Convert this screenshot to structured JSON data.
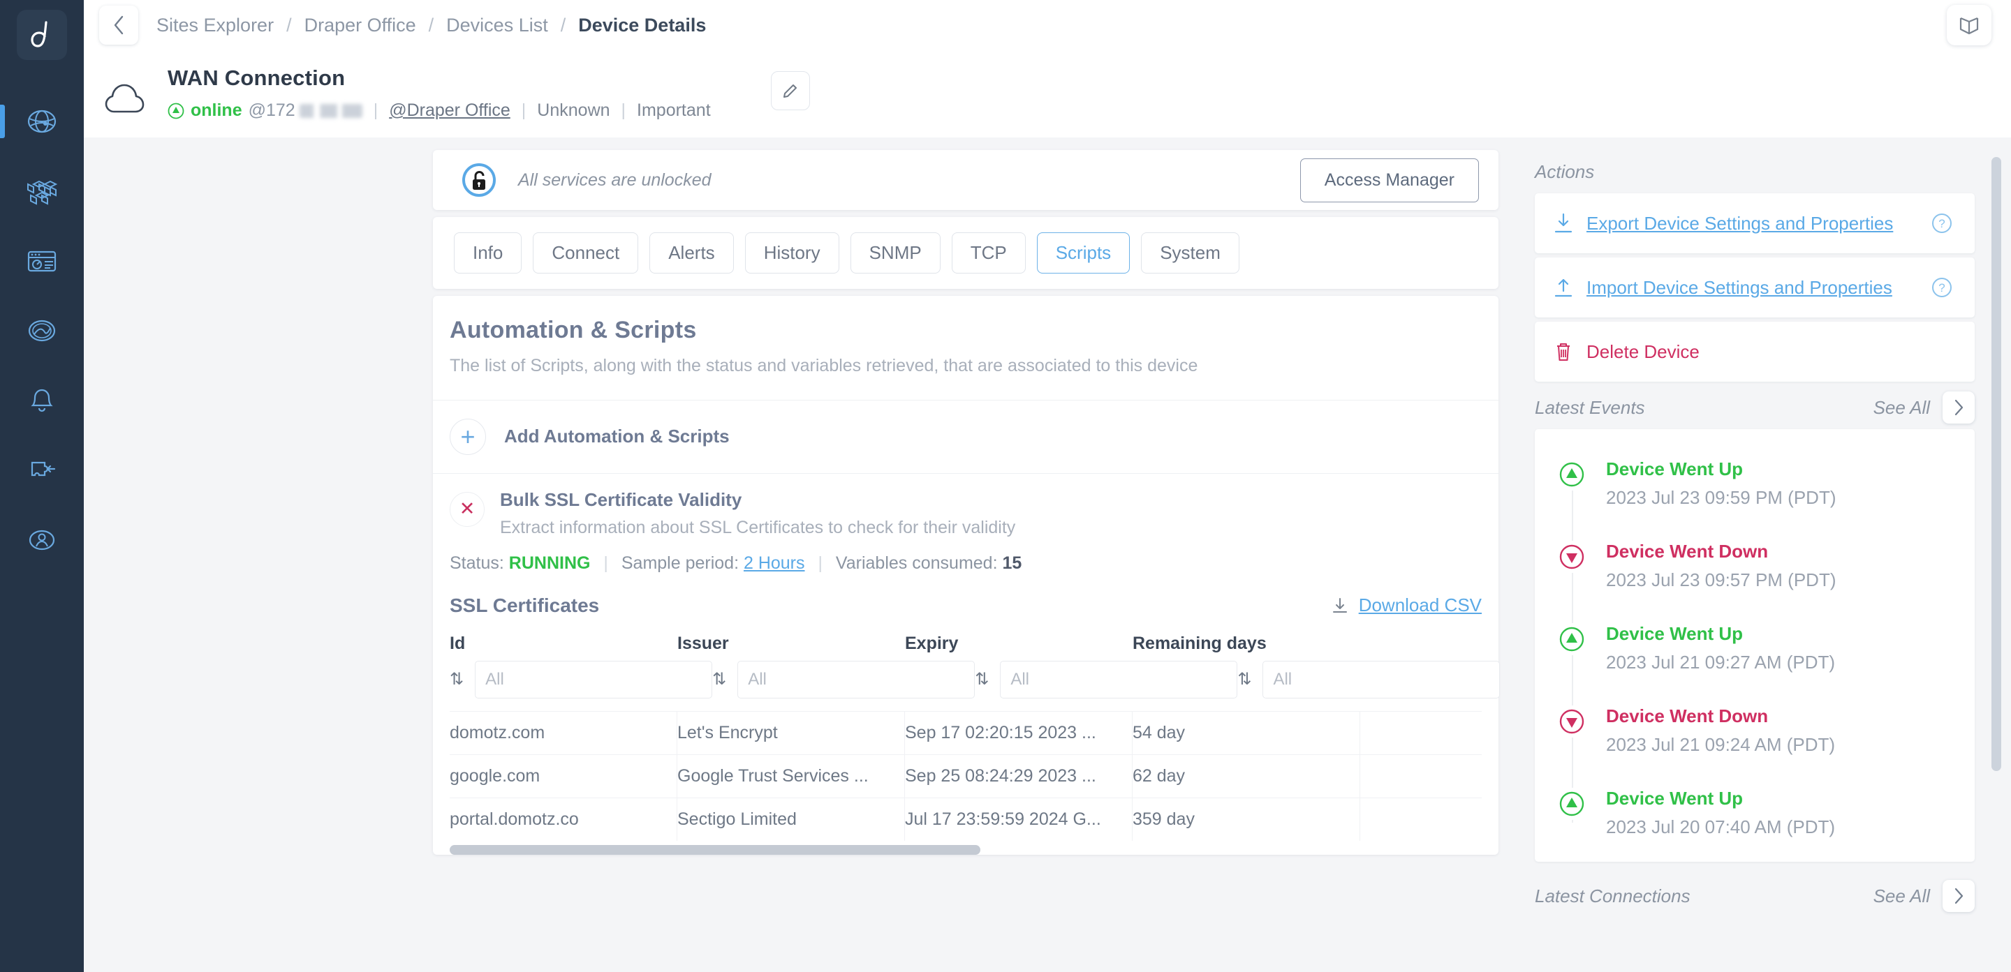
{
  "colors": {
    "rail_bg": "#253447",
    "accent_blue": "#5aa9e6",
    "green": "#30c048",
    "crimson": "#cf2f61",
    "slate": "#6e7a93"
  },
  "rail": {
    "logo": "domotz-logo-icon",
    "items": [
      {
        "name": "sidebar-item-sites-explorer",
        "icon": "globe-network-icon",
        "active": true
      },
      {
        "name": "sidebar-item-inventory",
        "icon": "cubes-icon",
        "active": false
      },
      {
        "name": "sidebar-item-dashboards",
        "icon": "dashboard-window-icon",
        "active": false
      },
      {
        "name": "sidebar-item-analytics",
        "icon": "analytics-globe-icon",
        "active": false
      },
      {
        "name": "sidebar-item-alerts",
        "icon": "bell-icon",
        "active": false
      },
      {
        "name": "sidebar-item-integrations",
        "icon": "puzzle-plugin-icon",
        "active": false
      },
      {
        "name": "sidebar-item-account",
        "icon": "user-icon",
        "active": false
      }
    ]
  },
  "topbar": {
    "back_icon": "chevron-left-icon",
    "book_icon": "book-icon",
    "breadcrumbs": [
      {
        "label": "Sites Explorer",
        "current": false
      },
      {
        "label": "Draper Office",
        "current": false
      },
      {
        "label": "Devices List",
        "current": false
      },
      {
        "label": "Device Details",
        "current": true
      }
    ],
    "separator": "/"
  },
  "device": {
    "icon": "cloud-icon",
    "title": "WAN Connection",
    "status": "online",
    "status_icon": "arrow-up-circle-icon",
    "ip_prefix": "@172",
    "site": "@Draper Office",
    "type": "Unknown",
    "importance": "Important",
    "edit_icon": "pencil-icon",
    "separator": "|"
  },
  "lock_bar": {
    "icon": "unlocked-padlock-icon",
    "text": "All services are unlocked",
    "access_button": "Access Manager"
  },
  "tabs": [
    {
      "label": "Info",
      "active": false
    },
    {
      "label": "Connect",
      "active": false
    },
    {
      "label": "Alerts",
      "active": false
    },
    {
      "label": "History",
      "active": false
    },
    {
      "label": "SNMP",
      "active": false
    },
    {
      "label": "TCP",
      "active": false
    },
    {
      "label": "Scripts",
      "active": true
    },
    {
      "label": "System",
      "active": false
    }
  ],
  "scripts_panel": {
    "title": "Automation & Scripts",
    "subtitle": "The list of Scripts, along with the status and variables retrieved, that are associated to this device",
    "add_label": "Add Automation & Scripts",
    "add_icon": "plus-icon",
    "script": {
      "badge_icon": "x-mark-icon",
      "name": "Bulk SSL Certificate Validity",
      "description": "Extract information about SSL Certificates to check for their validity",
      "status_label": "Status:",
      "status_value": "RUNNING",
      "sample_label": "Sample period:",
      "sample_value": "2 Hours",
      "variables_label": "Variables consumed:",
      "variables_value": "15",
      "separator": "|"
    },
    "table": {
      "title": "SSL Certificates",
      "download_label": "Download CSV",
      "download_icon": "download-icon",
      "sort_icon": "sort-updown-icon",
      "filter_placeholder": "All",
      "columns": [
        "Id",
        "Issuer",
        "Expiry",
        "Remaining days"
      ],
      "rows": [
        [
          "domotz.com",
          "Let's Encrypt",
          "Sep 17 02:20:15 2023 ...",
          "54 day"
        ],
        [
          "google.com",
          "Google Trust Services ...",
          "Sep 25 08:24:29 2023 ...",
          "62 day"
        ],
        [
          "portal.domotz.co",
          "Sectigo Limited",
          "Jul 17 23:59:59 2024 G...",
          "359 day"
        ]
      ]
    }
  },
  "actions": {
    "title": "Actions",
    "items": [
      {
        "label": "Export Device Settings and Properties",
        "icon": "download-arrow-icon",
        "help_icon": "question-circle-icon",
        "danger": false
      },
      {
        "label": "Import Device Settings and Properties",
        "icon": "upload-arrow-icon",
        "help_icon": "question-circle-icon",
        "danger": false
      },
      {
        "label": "Delete Device",
        "icon": "trash-icon",
        "help_icon": null,
        "danger": true
      }
    ]
  },
  "latest_events": {
    "title": "Latest Events",
    "see_all": "See All",
    "chevron_icon": "chevron-right-icon",
    "items": [
      {
        "name": "Device Went Up",
        "time": "2023 Jul 23 09:59 PM (PDT)",
        "direction": "up"
      },
      {
        "name": "Device Went Down",
        "time": "2023 Jul 23 09:57 PM (PDT)",
        "direction": "down"
      },
      {
        "name": "Device Went Up",
        "time": "2023 Jul 21 09:27 AM (PDT)",
        "direction": "up"
      },
      {
        "name": "Device Went Down",
        "time": "2023 Jul 21 09:24 AM (PDT)",
        "direction": "down"
      },
      {
        "name": "Device Went Up",
        "time": "2023 Jul 20 07:40 AM (PDT)",
        "direction": "up"
      }
    ]
  },
  "latest_connections": {
    "title": "Latest Connections",
    "see_all": "See All",
    "chevron_icon": "chevron-right-icon"
  }
}
